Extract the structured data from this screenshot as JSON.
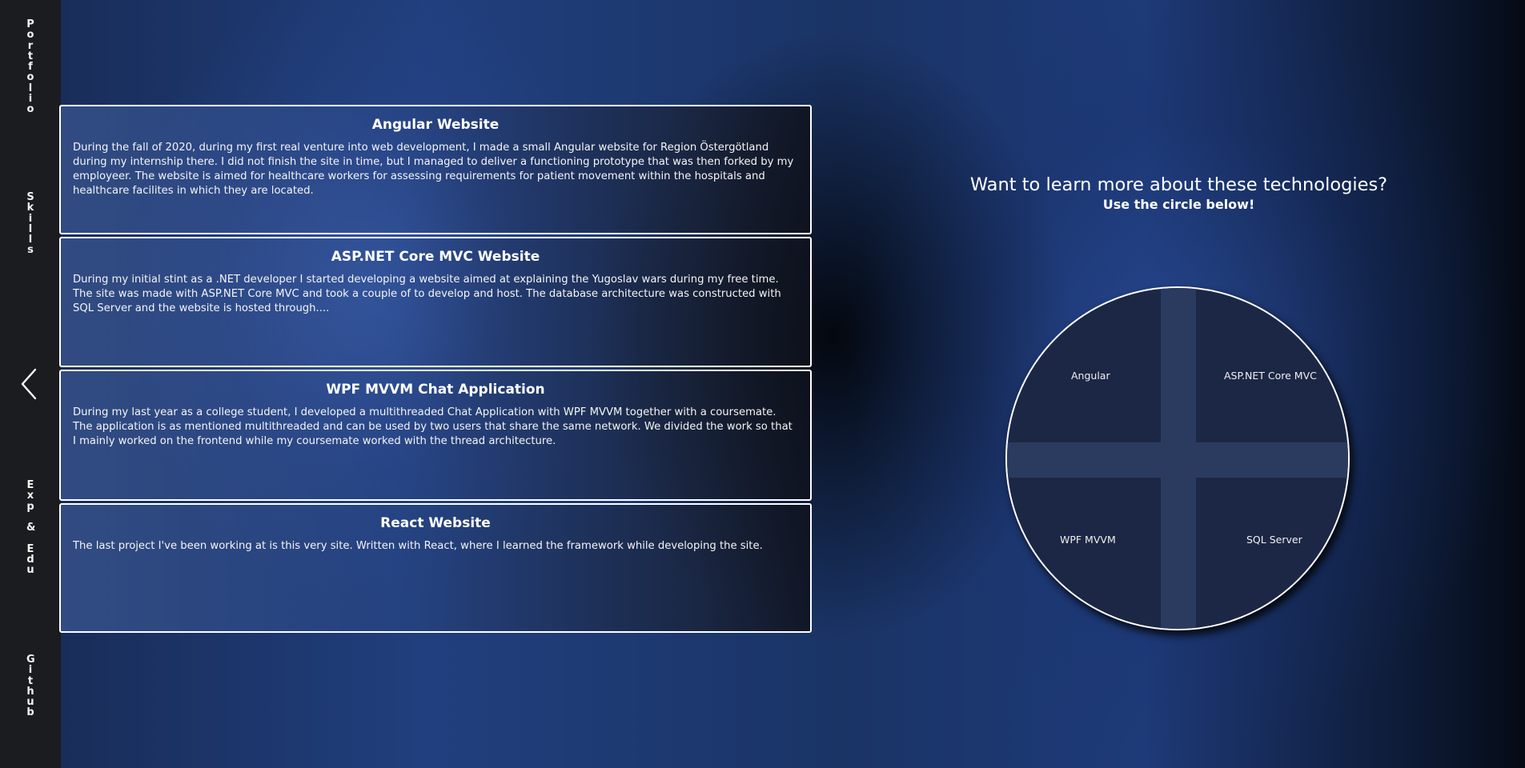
{
  "sidebar": {
    "portfolio": "Portfolio",
    "skills": "Skills",
    "exp_edu": "Exp\n&\nEdu",
    "github": "Github",
    "back_icon": "chevron-left-icon"
  },
  "projects": [
    {
      "title": "Angular Website",
      "description": "During the fall of 2020, during my first real venture into web development, I made a small Angular website for Region Östergötland during my internship there. I did not finish the site in time, but I managed to deliver a functioning prototype that was then forked by my employeer. The website is aimed for healthcare workers for assessing requirements for patient movement within the hospitals and healthcare facilites in which they are located."
    },
    {
      "title": "ASP.NET Core MVC Website",
      "description": "During my initial stint as a .NET developer I started developing a website aimed at explaining the Yugoslav wars during my free time. The site was made with ASP.NET Core MVC and took a couple of to develop and host. The database architecture was constructed with SQL Server and the website is hosted through...."
    },
    {
      "title": "WPF MVVM Chat Application",
      "description": "During my last year as a college student, I developed a multithreaded Chat Application with WPF MVVM together with a coursemate. The application is as mentioned multithreaded and can be used by two users that share the same network. We divided the work so that I mainly worked on the frontend while my coursemate worked with the thread architecture."
    },
    {
      "title": "React Website",
      "description": "The last project I've been working at is this very site. Written with React, where I learned the framework while developing the site."
    }
  ],
  "tech": {
    "heading": "Want to learn more about these technologies?",
    "subheading": "Use the circle below!",
    "quadrants": {
      "top_left": "Angular",
      "top_right": "ASP.NET Core MVC",
      "bottom_left": "WPF MVVM",
      "bottom_right": "SQL Server"
    }
  }
}
